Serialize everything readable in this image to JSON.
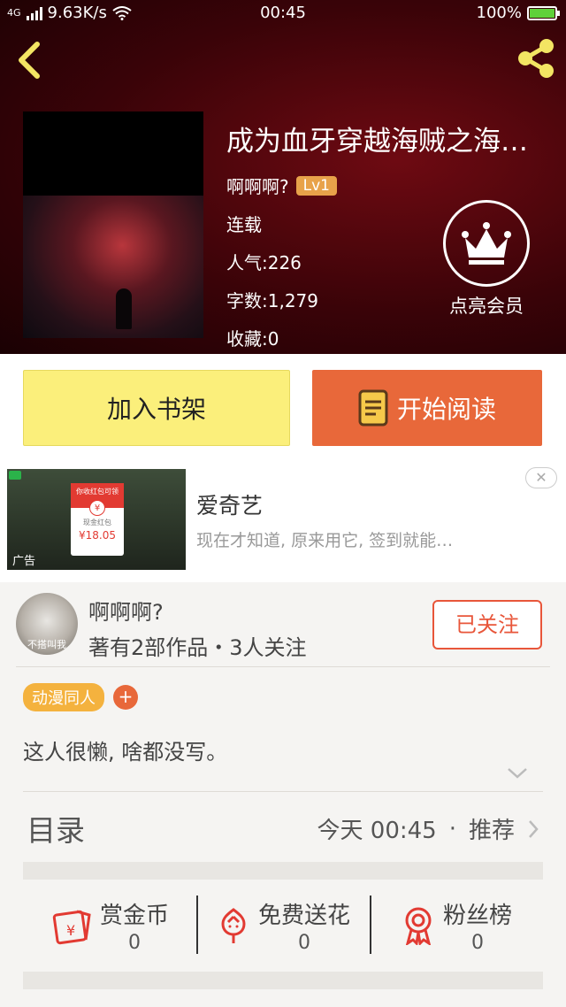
{
  "status_bar": {
    "network": "4G",
    "speed": "9.63K/s",
    "time": "00:45",
    "battery": "100%"
  },
  "colors": {
    "accent_orange": "#e8683a",
    "shelf_yellow": "#fbef7b",
    "follow_red": "#e8563a",
    "tag_yellow": "#f4b23e"
  },
  "book": {
    "title": "成为血牙穿越海贼之海…",
    "author": "啊啊啊?",
    "level": "Lv1",
    "status": "连载",
    "popularity": "人气:226",
    "word_count": "字数:1,279",
    "favorites": "收藏:0"
  },
  "vip": {
    "label": "点亮会员",
    "icon": "crown-icon"
  },
  "buttons": {
    "add_shelf": "加入书架",
    "start_read": "开始阅读"
  },
  "ad": {
    "name": "爱奇艺",
    "desc": "现在才知道, 原来用它, 签到就能…",
    "label": "广告",
    "envelope_title": "你收红包可领",
    "envelope_sub": "现金红包",
    "envelope_amount": "¥18.05",
    "close": "✕"
  },
  "author_card": {
    "name": "啊啊啊?",
    "stats": "著有2部作品・3人关注",
    "follow_label": "已关注",
    "avatar_caption": "不搭叫我",
    "tag": "动漫同人",
    "tag_add": "+",
    "bio": "这人很懒, 啥都没写。"
  },
  "catalog": {
    "label": "目录",
    "updated": "今天  00:45",
    "dot": "·",
    "recommend": "推荐"
  },
  "actions": [
    {
      "label": "赏金币",
      "count": "0",
      "icon": "red-envelope-icon"
    },
    {
      "label": "免费送花",
      "count": "0",
      "icon": "flower-icon"
    },
    {
      "label": "粉丝榜",
      "count": "0",
      "icon": "medal-icon"
    }
  ]
}
